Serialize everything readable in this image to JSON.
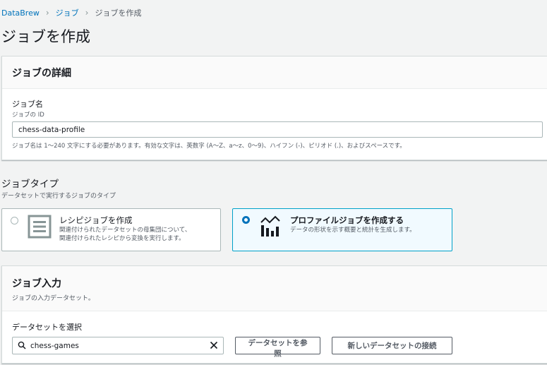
{
  "breadcrumb": {
    "items": [
      "DataBrew",
      "ジョブ"
    ],
    "current": "ジョブを作成"
  },
  "page_title": "ジョブを作成",
  "details": {
    "header": "ジョブの詳細",
    "name_label": "ジョブ名",
    "name_sublabel": "ジョブの ID",
    "name_value": "chess-data-profile",
    "name_hint": "ジョブ名は 1〜240 文字にする必要があります。有効な文字は、英数字 (A〜Z、a〜z、0〜9)、ハイフン (-)、ピリオド (.)、およびスペースです。"
  },
  "job_type": {
    "title": "ジョブタイプ",
    "description": "データセットで実行するジョブのタイプ",
    "options": [
      {
        "title": "レシピジョブを作成",
        "desc_line1": "関連付けられたデータセットの母集団について、",
        "desc_line2": "関連付けられたレシピから変換を実行します。",
        "icon": "recipe-list-icon",
        "selected": false
      },
      {
        "title": "プロファイルジョブを作成する",
        "desc_line1": "データの形状を示す概要と統計を生成します。",
        "desc_line2": "",
        "icon": "profile-chart-icon",
        "selected": true
      }
    ]
  },
  "job_input": {
    "header": "ジョブ入力",
    "description": "ジョブの入力データセット。",
    "select_label": "データセットを選択",
    "search_value": "chess-games",
    "browse_button": "データセットを参照",
    "connect_button": "新しいデータセットの接続"
  },
  "colors": {
    "link": "#0073bb",
    "selected_border": "#00a1c9",
    "selected_bg": "#f1faff"
  }
}
